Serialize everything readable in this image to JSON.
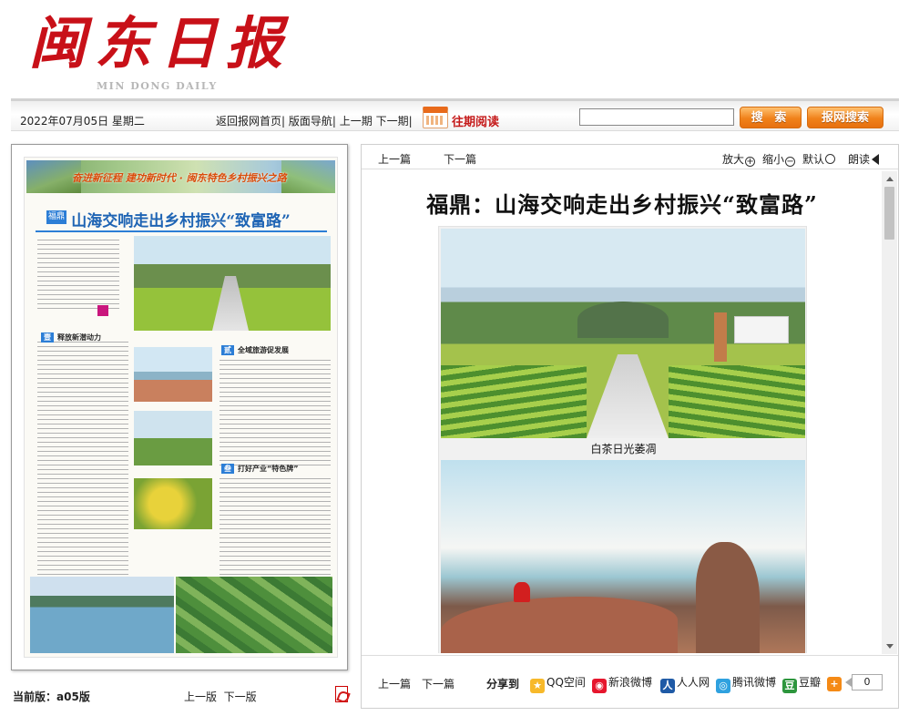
{
  "masthead": {
    "logo_cn": "闽东日报",
    "logo_en": "MIN DONG DAILY"
  },
  "toolbar": {
    "date": "2022年07月05日 星期二",
    "nav": [
      "返回报网首页",
      "版面导航",
      "上一期",
      "下一期"
    ],
    "past": "往期阅读",
    "search_value": "",
    "search_button": "搜 索",
    "site_search_button": "报网搜索"
  },
  "left_page": {
    "banner": "奋进新征程 建功新时代 · 闽东特色乡村振兴之路",
    "title": "山海交响走出乡村振兴“致富路”",
    "tag": "福鼎",
    "sections": [
      "释放新潜动力",
      "全域旅游促发展",
      "打好产业“特色牌”"
    ],
    "current_label": "当前版：",
    "current_value": "a05版",
    "prev": "上一版",
    "next": "下一版"
  },
  "article": {
    "prev": "上一篇",
    "next": "下一篇",
    "zoom_in": "放大",
    "zoom_out": "缩小",
    "default": "默认",
    "read": "朗读",
    "headline": "福鼎：山海交响走出乡村振兴“致富路”",
    "caption": "白茶日光萎凋"
  },
  "share": {
    "prev": "上一篇",
    "next": "下一篇",
    "label": "分享到",
    "targets": [
      {
        "name": "QQ空间",
        "color": "#f7b92a",
        "glyph": "★"
      },
      {
        "name": "新浪微博",
        "color": "#e6162d",
        "glyph": "◉"
      },
      {
        "name": "人人网",
        "color": "#1f5aa6",
        "glyph": "人"
      },
      {
        "name": "腾讯微博",
        "color": "#2fa1df",
        "glyph": "◎"
      },
      {
        "name": "豆瓣",
        "color": "#2d963d",
        "glyph": "豆"
      },
      {
        "name": "",
        "color": "#f58a16",
        "glyph": "+"
      }
    ],
    "count": "0"
  }
}
